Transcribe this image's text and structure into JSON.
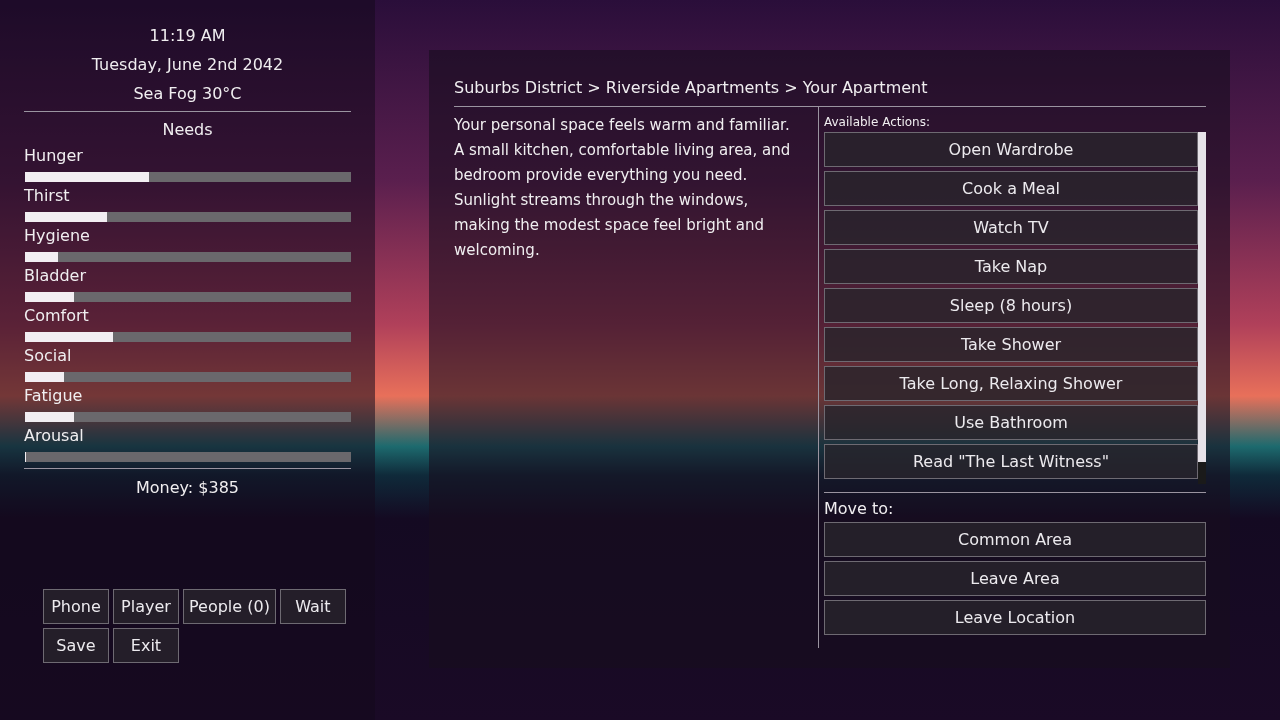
{
  "clock": {
    "time": "11:19 AM",
    "date": "Tuesday, June 2nd 2042",
    "weather": "Sea Fog 30°C"
  },
  "needs": {
    "title": "Needs",
    "items": [
      {
        "name": "Hunger",
        "level": 0.38
      },
      {
        "name": "Thirst",
        "level": 0.25
      },
      {
        "name": "Hygiene",
        "level": 0.1
      },
      {
        "name": "Bladder",
        "level": 0.15
      },
      {
        "name": "Comfort",
        "level": 0.27
      },
      {
        "name": "Social",
        "level": 0.12
      },
      {
        "name": "Fatigue",
        "level": 0.15
      },
      {
        "name": "Arousal",
        "level": 0
      }
    ]
  },
  "money": "Money: $385",
  "menu_buttons": [
    [
      "Phone",
      "Player",
      "People (0)",
      "Wait"
    ],
    [
      "Save",
      "Exit"
    ]
  ],
  "location": {
    "breadcrumb": "Suburbs District > Riverside Apartments > Your Apartment",
    "description": "Your personal space feels warm and familiar. A small kitchen, comfortable living area, and bedroom provide everything you need. Sunlight streams through the windows, making the modest space feel bright and welcoming."
  },
  "actions": {
    "title": "Available Actions:",
    "items": [
      "Open Wardrobe",
      "Cook a Meal",
      "Watch TV",
      "Take Nap",
      "Sleep (8 hours)",
      "Take Shower",
      "Take Long, Relaxing Shower",
      "Use Bathroom",
      "Read \"The Last Witness\""
    ]
  },
  "move": {
    "title": "Move to:",
    "items": [
      "Common Area",
      "Leave Area",
      "Leave Location"
    ]
  }
}
